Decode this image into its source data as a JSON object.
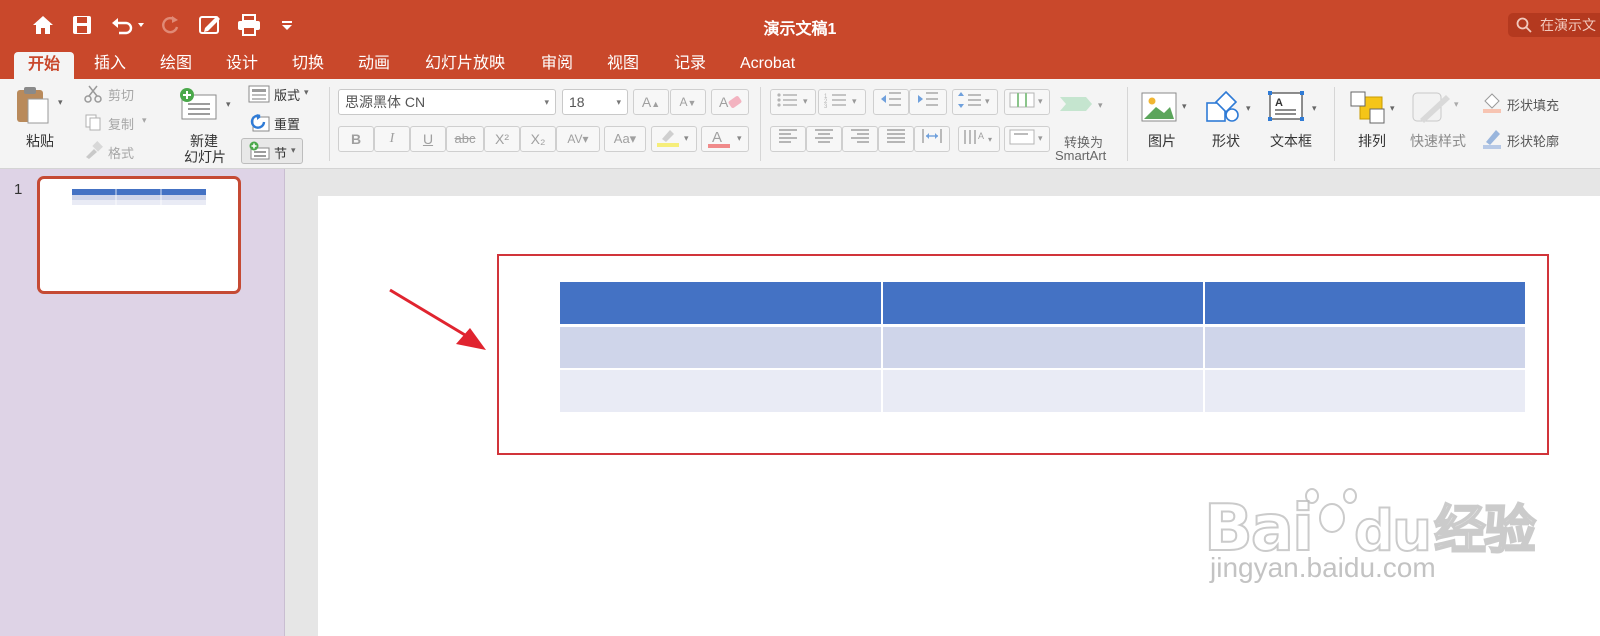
{
  "window": {
    "title": "演示文稿1",
    "search_placeholder": "在演示文"
  },
  "tabs": [
    "开始",
    "插入",
    "绘图",
    "设计",
    "切换",
    "动画",
    "幻灯片放映",
    "审阅",
    "视图",
    "记录",
    "Acrobat"
  ],
  "active_tab": "开始",
  "ribbon": {
    "paste": "粘贴",
    "cut": "剪切",
    "copy": "复制",
    "format": "格式",
    "new_slide_line1": "新建",
    "new_slide_line2": "幻灯片",
    "layout": "版式",
    "reset": "重置",
    "section": "节",
    "font_name": "思源黑体 CN",
    "font_size": "18",
    "bold": "B",
    "italic": "I",
    "underline": "U",
    "strike": "abc",
    "superscript": "X²",
    "subscript": "X₂",
    "convert_smartart_line1": "转换为",
    "convert_smartart_line2": "SmartArt",
    "picture": "图片",
    "shape": "形状",
    "textbox": "文本框",
    "arrange": "排列",
    "quick_styles": "快速样式",
    "shape_fill": "形状填充",
    "shape_outline": "形状轮廓"
  },
  "slides_panel": {
    "slide_number": "1"
  },
  "table": {
    "columns": 3,
    "rows": 3,
    "colors": {
      "header": "#4472c4",
      "band1": "#cfd5ea",
      "band2": "#e9ebf5"
    }
  },
  "annotation": {
    "arrow_color": "#e0242f",
    "box_color": "#d1343a"
  },
  "watermark": {
    "logo": "Bai du 经验",
    "url": "jingyan.baidu.com"
  }
}
